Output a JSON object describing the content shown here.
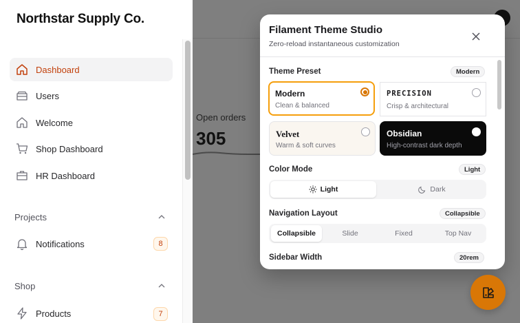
{
  "brand": "Northstar Supply Co.",
  "sidebar": {
    "items": [
      {
        "label": "Dashboard",
        "icon": "home-icon",
        "active": true
      },
      {
        "label": "Users",
        "icon": "stack-icon"
      },
      {
        "label": "Welcome",
        "icon": "home-icon"
      },
      {
        "label": "Shop Dashboard",
        "icon": "cart-icon"
      },
      {
        "label": "HR Dashboard",
        "icon": "briefcase-icon"
      }
    ],
    "groups": [
      {
        "label": "Projects",
        "items": [
          {
            "label": "Notifications",
            "icon": "bell-icon",
            "badge": "8"
          }
        ]
      },
      {
        "label": "Shop",
        "items": [
          {
            "label": "Products",
            "icon": "bolt-icon",
            "badge": "7"
          }
        ]
      }
    ]
  },
  "main": {
    "stat": {
      "label": "Open orders",
      "value": "305"
    }
  },
  "modal": {
    "title": "Filament Theme Studio",
    "subtitle": "Zero-reload instantaneous customization",
    "theme_preset": {
      "label": "Theme Preset",
      "value": "Modern",
      "options": [
        {
          "name": "Modern",
          "desc": "Clean & balanced",
          "selected": true
        },
        {
          "name": "PRECISION",
          "desc": "Crisp & architectural"
        },
        {
          "name": "Velvet",
          "desc": "Warm & soft curves"
        },
        {
          "name": "Obsidian",
          "desc": "High-contrast dark depth"
        }
      ]
    },
    "color_mode": {
      "label": "Color Mode",
      "value": "Light",
      "options": [
        "Light",
        "Dark"
      ]
    },
    "navigation_layout": {
      "label": "Navigation Layout",
      "value": "Collapsible",
      "options": [
        "Collapsible",
        "Slide",
        "Fixed",
        "Top Nav"
      ]
    },
    "sidebar_width": {
      "label": "Sidebar Width",
      "value": "20rem"
    }
  },
  "colors": {
    "accent": "#d97706",
    "active_text": "#c2410c",
    "overlay": "#7f7f7f"
  }
}
